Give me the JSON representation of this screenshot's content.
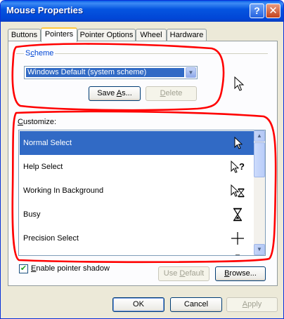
{
  "window": {
    "title": "Mouse Properties"
  },
  "titlebar": {
    "help_glyph": "?",
    "close_glyph": "✕"
  },
  "tabs": [
    {
      "label": "Buttons"
    },
    {
      "label": "Pointers"
    },
    {
      "label": "Pointer Options"
    },
    {
      "label": "Wheel"
    },
    {
      "label": "Hardware"
    }
  ],
  "active_tab": "Pointers",
  "scheme": {
    "group_label": "Scheme",
    "selected": "Windows Default (system scheme)",
    "save_as_label": "Save As...",
    "delete_label": "Delete"
  },
  "customize": {
    "label": "Customize:",
    "items": [
      {
        "label": "Normal Select",
        "icon": "arrow-pointer-icon",
        "selected": true
      },
      {
        "label": "Help Select",
        "icon": "help-select-pointer-icon"
      },
      {
        "label": "Working In Background",
        "icon": "working-background-pointer-icon"
      },
      {
        "label": "Busy",
        "icon": "hourglass-icon"
      },
      {
        "label": "Precision Select",
        "icon": "crosshair-icon"
      }
    ]
  },
  "shadow": {
    "label": "Enable pointer shadow",
    "checked": true
  },
  "actions": {
    "use_default_label": "Use Default",
    "browse_label": "Browse..."
  },
  "footer": {
    "ok_label": "OK",
    "cancel_label": "Cancel",
    "apply_label": "Apply"
  },
  "colors": {
    "titlebar": "#0a5fe8",
    "selection": "#316ac5",
    "annotation": "#ff0000"
  }
}
